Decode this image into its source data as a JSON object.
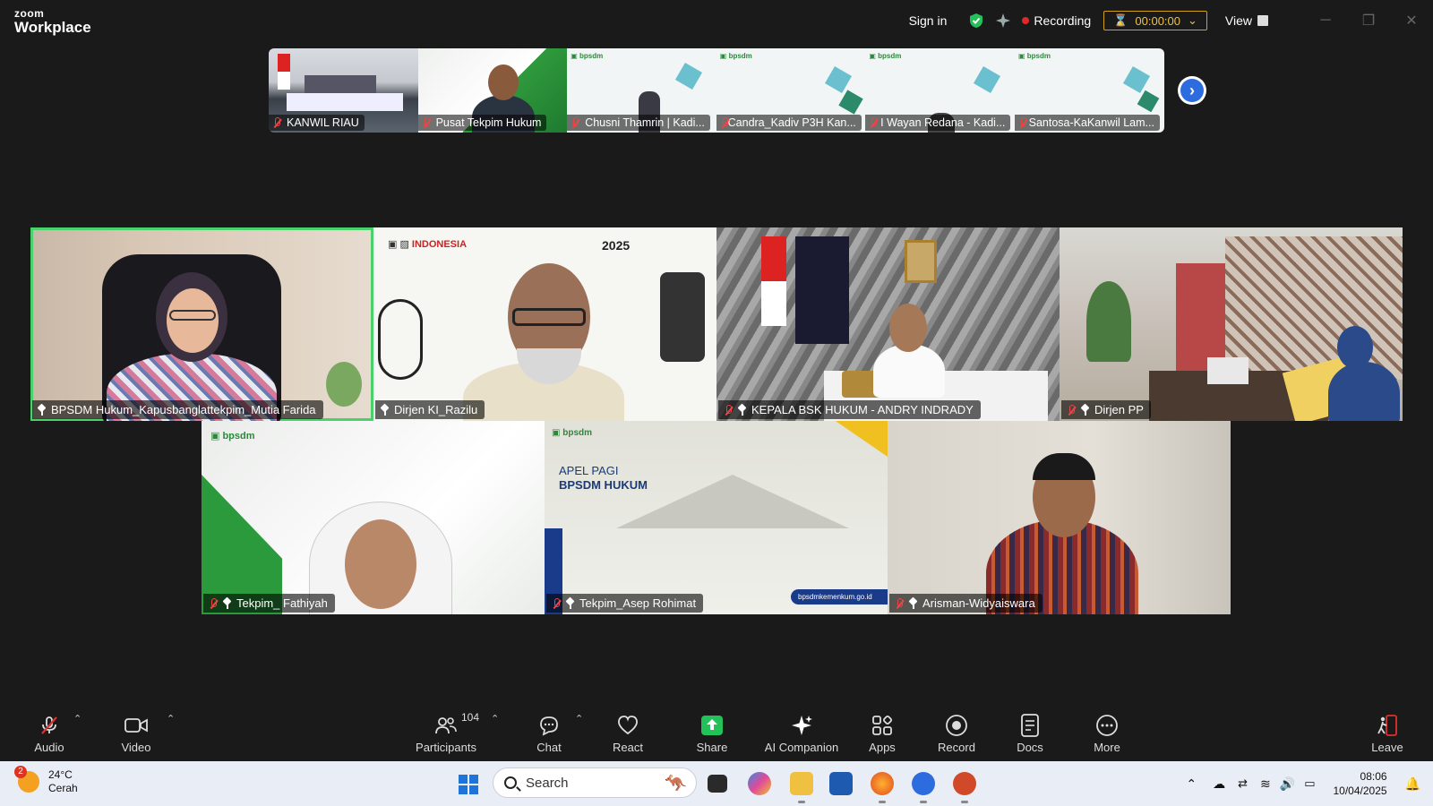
{
  "app": {
    "logo_top": "zoom",
    "logo_bottom": "Workplace"
  },
  "titlebar": {
    "sign_in": "Sign in",
    "recording_label": "Recording",
    "timer": "00:00:00",
    "view_label": "View"
  },
  "thumbnails": [
    {
      "name": "KANWIL RIAU"
    },
    {
      "name": "Pusat Tekpim Hukum"
    },
    {
      "name": "Chusni Thamrin | Kadi..."
    },
    {
      "name": "Candra_Kadiv P3H Kan..."
    },
    {
      "name": "I Wayan Redana - Kadi..."
    },
    {
      "name": "Santosa-KaKanwil Lam..."
    }
  ],
  "gallery": [
    {
      "name": "BPSDM Hukum_Kapusbanglattekpim_Mutia Farida"
    },
    {
      "name": "Dirjen KI_Razilu"
    },
    {
      "name": "KEPALA BSK HUKUM - ANDRY INDRADY"
    },
    {
      "name": "Dirjen PP"
    },
    {
      "name": "Tekpim_ Fathiyah"
    },
    {
      "name": "Tekpim_Asep Rohimat"
    },
    {
      "name": "Arisman-Widyaiswara"
    }
  ],
  "slides": {
    "bpsdm_logo": "bpsdm",
    "apel_line1": "APEL PAGI",
    "apel_line2": "BPSDM HUKUM",
    "website": "bpsdmkemenkum.go.id",
    "year_banner": "2025"
  },
  "toolbar": {
    "audio": "Audio",
    "video": "Video",
    "participants": "Participants",
    "participants_count": "104",
    "chat": "Chat",
    "react": "React",
    "share": "Share",
    "ai_companion": "AI Companion",
    "apps": "Apps",
    "record": "Record",
    "docs": "Docs",
    "more": "More",
    "leave": "Leave"
  },
  "taskbar": {
    "weather_badge": "2",
    "temperature": "24°C",
    "condition": "Cerah",
    "search_placeholder": "Search",
    "time": "08:06",
    "date": "10/04/2025"
  },
  "colors": {
    "active_speaker": "#4bd16b",
    "recording_dot": "#e02828",
    "timer_border": "#d4a017",
    "share_green": "#23c15a",
    "leave_red": "#e03030"
  }
}
